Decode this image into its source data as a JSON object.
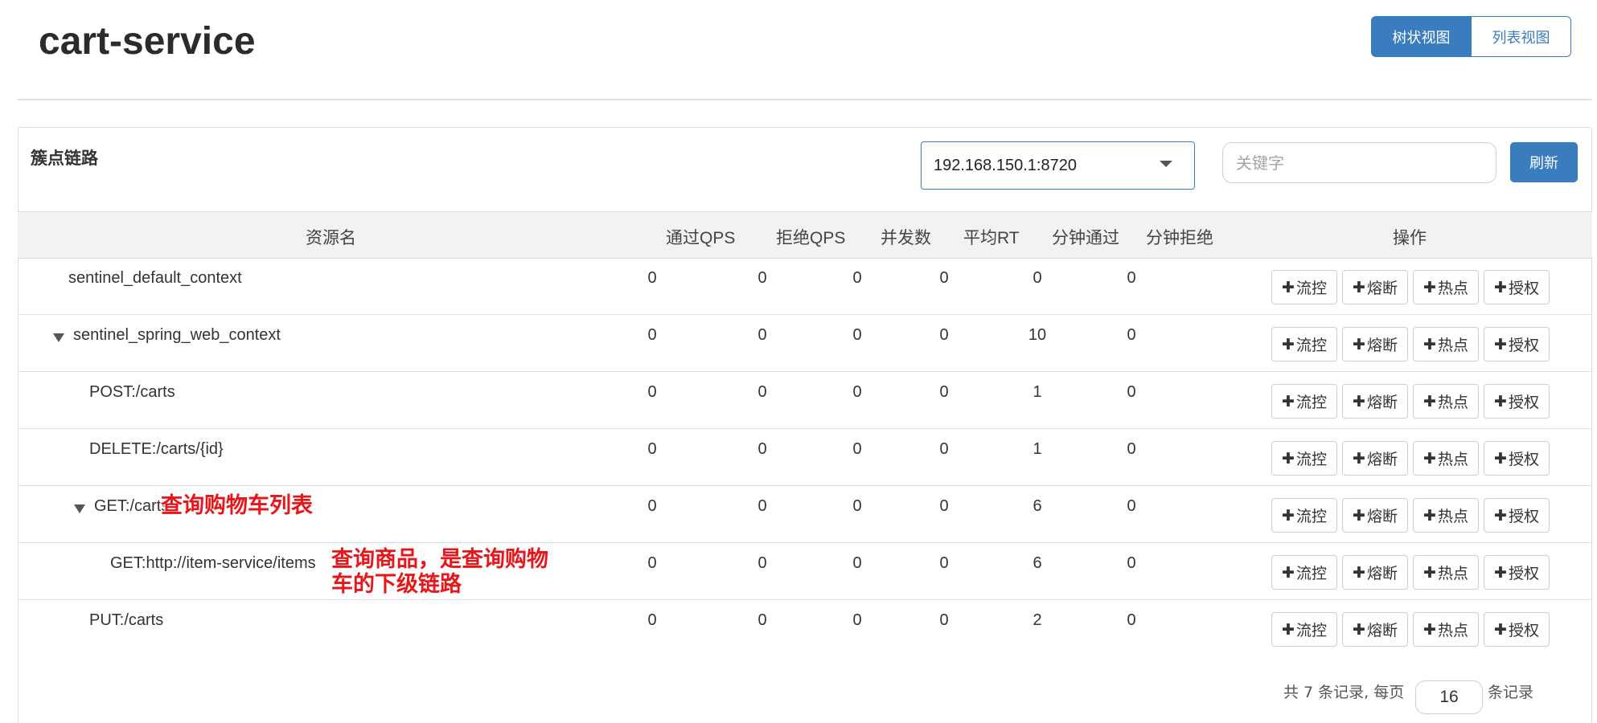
{
  "page": {
    "title": "cart-service"
  },
  "view_switch": {
    "tree_label": "树状视图",
    "list_label": "列表视图"
  },
  "panel": {
    "title": "簇点链路",
    "machine_value": "192.168.150.1:8720",
    "keyword_placeholder": "关键字",
    "refresh_label": "刷新"
  },
  "table": {
    "columns": [
      "资源名",
      "通过QPS",
      "拒绝QPS",
      "并发数",
      "平均RT",
      "分钟通过",
      "分钟拒绝",
      "操作"
    ],
    "op_labels": [
      "流控",
      "熔断",
      "热点",
      "授权"
    ],
    "rows": [
      {
        "name": "sentinel_default_context",
        "expanded": null,
        "values": [
          "0",
          "0",
          "0",
          "0",
          "0",
          "0"
        ]
      },
      {
        "name": "sentinel_spring_web_context",
        "expanded": true,
        "values": [
          "0",
          "0",
          "0",
          "0",
          "10",
          "0"
        ]
      },
      {
        "name": "POST:/carts",
        "expanded": null,
        "values": [
          "0",
          "0",
          "0",
          "0",
          "1",
          "0"
        ]
      },
      {
        "name": "DELETE:/carts/{id}",
        "expanded": null,
        "values": [
          "0",
          "0",
          "0",
          "0",
          "1",
          "0"
        ]
      },
      {
        "name": "GET:/carts",
        "expanded": true,
        "values": [
          "0",
          "0",
          "0",
          "0",
          "6",
          "0"
        ]
      },
      {
        "name": "GET:http://item-service/items",
        "expanded": null,
        "values": [
          "0",
          "0",
          "0",
          "0",
          "6",
          "0"
        ]
      },
      {
        "name": "PUT:/carts",
        "expanded": null,
        "values": [
          "0",
          "0",
          "0",
          "0",
          "2",
          "0"
        ]
      }
    ]
  },
  "annotations": {
    "get_carts": "查询购物车列表",
    "item_line1": "查询商品，是查询购物",
    "item_line2": "车的下级链路"
  },
  "pagination": {
    "prefix": "共 7 条记录, 每页",
    "page_size": "16",
    "suffix": "条记录"
  },
  "colors": {
    "primary": "#3a7dbf",
    "annotation": "#e8161a"
  },
  "icons": {
    "op_button": "plus-icon",
    "expand": "caret-down-icon"
  }
}
